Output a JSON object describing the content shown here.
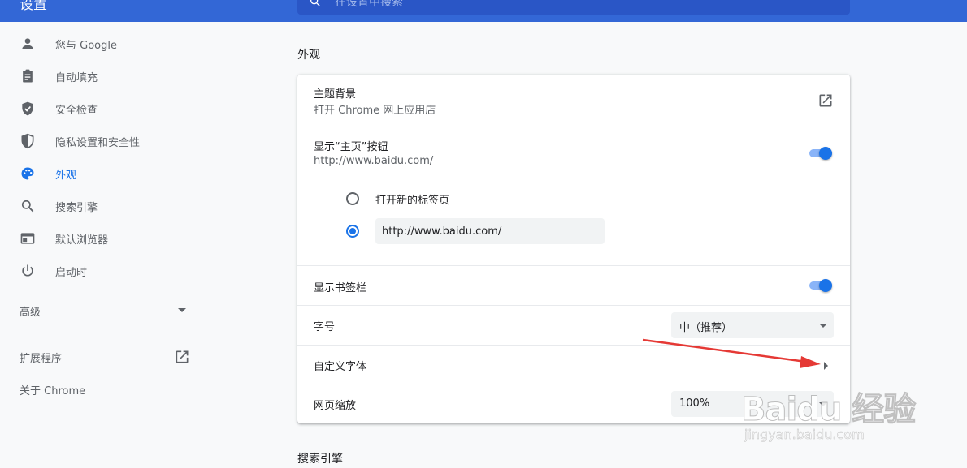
{
  "header": {
    "title": "设置",
    "search_placeholder": "在设置中搜索"
  },
  "sidebar": {
    "items": [
      {
        "label": "您与 Google",
        "icon": "person-icon"
      },
      {
        "label": "自动填充",
        "icon": "clipboard-icon"
      },
      {
        "label": "安全检查",
        "icon": "shield-check-icon"
      },
      {
        "label": "隐私设置和安全性",
        "icon": "shield-half-icon"
      },
      {
        "label": "外观",
        "icon": "palette-icon",
        "active": true
      },
      {
        "label": "搜索引擎",
        "icon": "search-icon"
      },
      {
        "label": "默认浏览器",
        "icon": "browser-icon"
      },
      {
        "label": "启动时",
        "icon": "power-icon"
      }
    ],
    "advanced_label": "高级",
    "extensions_label": "扩展程序",
    "about_label": "关于 Chrome"
  },
  "appearance": {
    "section_title": "外观",
    "theme": {
      "title": "主题背景",
      "subtitle": "打开 Chrome 网上应用店"
    },
    "home_button": {
      "title": "显示“主页”按钮",
      "subtitle": "http://www.baidu.com/",
      "enabled": true,
      "option_new_tab": "打开新的标签页",
      "custom_url": "http://www.baidu.com/",
      "selected": "custom"
    },
    "bookmarks_bar": {
      "title": "显示书签栏",
      "enabled": true
    },
    "font_size": {
      "title": "字号",
      "value": "中（推荐）"
    },
    "custom_fonts": {
      "title": "自定义字体"
    },
    "page_zoom": {
      "title": "网页缩放",
      "value": "100%"
    }
  },
  "search_engine_section_title": "搜索引擎",
  "watermark": {
    "text": "Baidu 经验",
    "url": "jingyan.baidu.com"
  },
  "colors": {
    "accent": "#1a73e8",
    "header": "#3367d6",
    "annotation_arrow": "#e53935"
  }
}
